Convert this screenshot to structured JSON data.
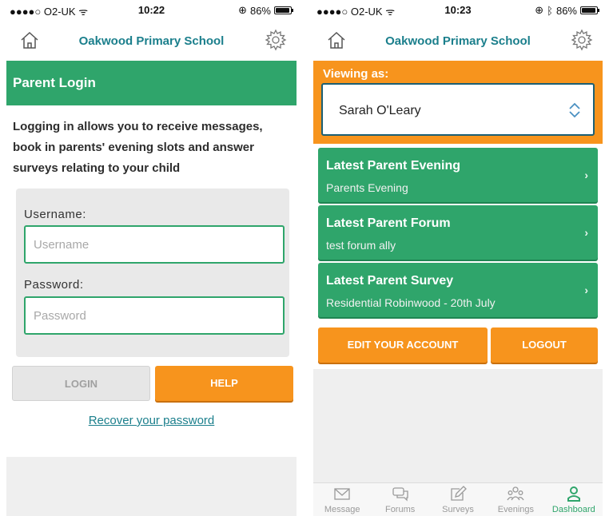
{
  "screens": [
    {
      "status": {
        "carrier": "●●●●○ O2-UK ᯤ",
        "time": "10:22",
        "battery": "86%",
        "battery_level": 0.86
      },
      "header": {
        "title": "Oakwood Primary School"
      },
      "login": {
        "title": "Parent Login",
        "intro": "Logging in allows you to receive messages, book in parents' evening slots and answer surveys relating to your child",
        "username_label": "Username:",
        "username_placeholder": "Username",
        "password_label": "Password:",
        "password_placeholder": "Password",
        "login_button": "LOGIN",
        "help_button": "HELP",
        "recover_link": "Recover your password"
      }
    },
    {
      "status": {
        "carrier": "●●●●○ O2-UK ᯤ",
        "time": "10:23",
        "battery": "86%",
        "battery_level": 0.86
      },
      "header": {
        "title": "Oakwood Primary School"
      },
      "viewing": {
        "label": "Viewing as:",
        "selected": "Sarah O'Leary"
      },
      "cards": [
        {
          "title": "Latest Parent Evening",
          "subtitle": "Parents Evening"
        },
        {
          "title": "Latest Parent Forum",
          "subtitle": "test forum ally"
        },
        {
          "title": "Latest Parent Survey",
          "subtitle": "Residential Robinwood - 20th July"
        }
      ],
      "buttons": {
        "edit": "EDIT YOUR ACCOUNT",
        "logout": "LOGOUT"
      },
      "tabs": [
        {
          "label": "Message",
          "icon": "envelope-icon"
        },
        {
          "label": "Forums",
          "icon": "chat-bubbles-icon"
        },
        {
          "label": "Surveys",
          "icon": "edit-icon"
        },
        {
          "label": "Evenings",
          "icon": "people-icon"
        },
        {
          "label": "Dashboard",
          "icon": "person-icon",
          "active": true
        }
      ]
    }
  ],
  "colors": {
    "green": "#2fa56b",
    "orange": "#f7941d",
    "teal": "#1b7f8c",
    "select_border": "#1b5f74"
  }
}
